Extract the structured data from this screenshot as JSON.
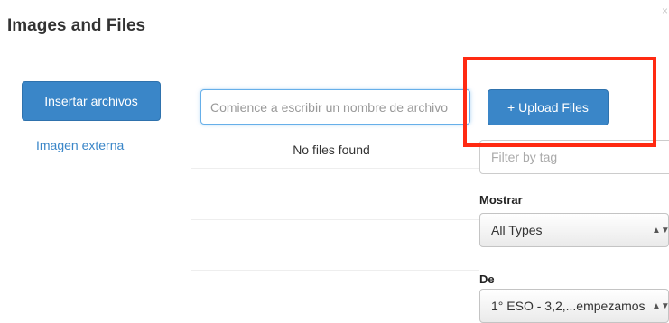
{
  "modal": {
    "title": "Images and Files",
    "close_glyph": "×"
  },
  "sidebar": {
    "insert_button_label": "Insertar archivos",
    "external_link_label": "Imagen externa"
  },
  "search": {
    "placeholder": "Comience a escribir un nombre de archivo",
    "value": ""
  },
  "file_list": {
    "empty_message": "No files found"
  },
  "upload": {
    "button_label": "+ Upload Files"
  },
  "filters": {
    "tag_placeholder": "Filter by tag",
    "show_label": "Mostrar",
    "type_selected": "All Types",
    "from_label": "De",
    "source_selected": "1° ESO - 3,2,...empezamos",
    "select_arrow_glyph": "▲▼"
  },
  "colors": {
    "primary": "#3a86c8",
    "highlight": "#ff2a12"
  }
}
